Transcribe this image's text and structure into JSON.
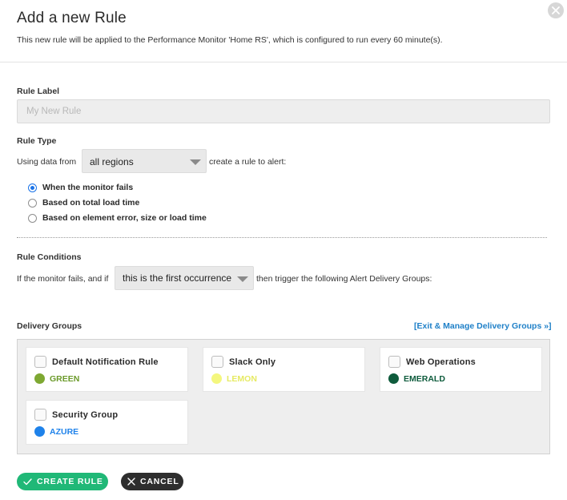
{
  "header": {
    "title": "Add a new Rule",
    "subtitle": "This new rule will be applied to the Performance Monitor 'Home RS', which is configured to run every 60 minute(s)."
  },
  "rule_label": {
    "label": "Rule Label",
    "placeholder": "My New Rule",
    "value": ""
  },
  "rule_type": {
    "label": "Rule Type",
    "prefix": "Using data from",
    "region_select": "all regions",
    "suffix": "create a rule to alert:",
    "options": [
      {
        "label": "When the monitor fails",
        "checked": true
      },
      {
        "label": "Based on total load time",
        "checked": false
      },
      {
        "label": "Based on element error, size or load time",
        "checked": false
      }
    ]
  },
  "rule_conditions": {
    "label": "Rule Conditions",
    "prefix": "If the monitor fails, and if",
    "occurrence_select": "this is the first occurrence",
    "suffix": "then trigger the following Alert Delivery Groups:"
  },
  "delivery_groups": {
    "label": "Delivery Groups",
    "manage_link": "[Exit & Manage Delivery Groups »]",
    "groups": [
      {
        "name": "Default Notification Rule",
        "color_name": "GREEN",
        "color": "#7ea832",
        "checked": false
      },
      {
        "name": "Slack Only",
        "color_name": "LEMON",
        "color": "#f4f77e",
        "checked": false
      },
      {
        "name": "Web Operations",
        "color_name": "EMERALD",
        "color": "#0e5b3c",
        "checked": false
      },
      {
        "name": "Security Group",
        "color_name": "AZURE",
        "color": "#1e82ea",
        "checked": false
      }
    ]
  },
  "actions": {
    "create_label": "CREATE RULE",
    "cancel_label": "CANCEL"
  },
  "colors": {
    "accent_green": "#20b877",
    "accent_blue": "#1a73e8",
    "link_blue": "#1f80c8",
    "dark": "#2e2e2e"
  },
  "icons": {
    "close": "close-icon",
    "create": "check-icon",
    "cancel": "x-icon",
    "select": "chevron-down-icon"
  }
}
